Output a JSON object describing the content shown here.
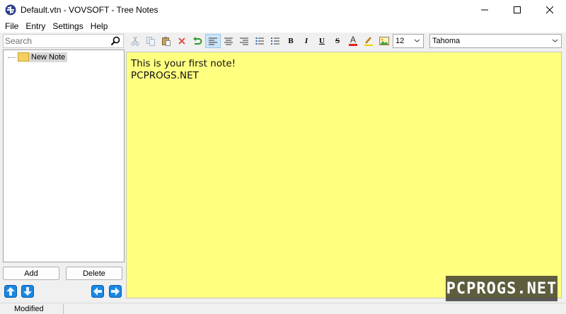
{
  "window": {
    "title": "Default.vtn - VOVSOFT - Tree Notes",
    "controls": [
      "minimize",
      "maximize",
      "close"
    ]
  },
  "menu": {
    "items": [
      "File",
      "Entry",
      "Settings",
      "Help"
    ]
  },
  "search": {
    "placeholder": "Search",
    "value": ""
  },
  "toolbar": {
    "buttons": [
      "cut-icon",
      "copy-icon",
      "paste-icon",
      "delete-icon",
      "undo-icon",
      "align-left-icon",
      "align-center-icon",
      "align-right-icon",
      "bullet-list-icon",
      "numbered-list-icon",
      "bold-icon",
      "italic-icon",
      "underline-icon",
      "strikethrough-icon",
      "font-color-icon",
      "highlight-icon",
      "insert-image-icon"
    ],
    "active": "align-left-icon",
    "bold_glyph": "B",
    "italic_glyph": "I",
    "underline_glyph": "U",
    "strike_glyph": "S",
    "fontcolor_glyph": "A",
    "font_size": "12",
    "font_name": "Tahoma"
  },
  "tree": {
    "nodes": [
      {
        "label": "New Note",
        "selected": true
      }
    ]
  },
  "editor": {
    "background": "#ffff80",
    "lines": [
      "This is your first note!",
      "PCPROGS.NET"
    ]
  },
  "actions": {
    "add_label": "Add",
    "delete_label": "Delete"
  },
  "status": {
    "text": "Modified"
  },
  "watermark": {
    "text": "PCPROGS.NET"
  }
}
